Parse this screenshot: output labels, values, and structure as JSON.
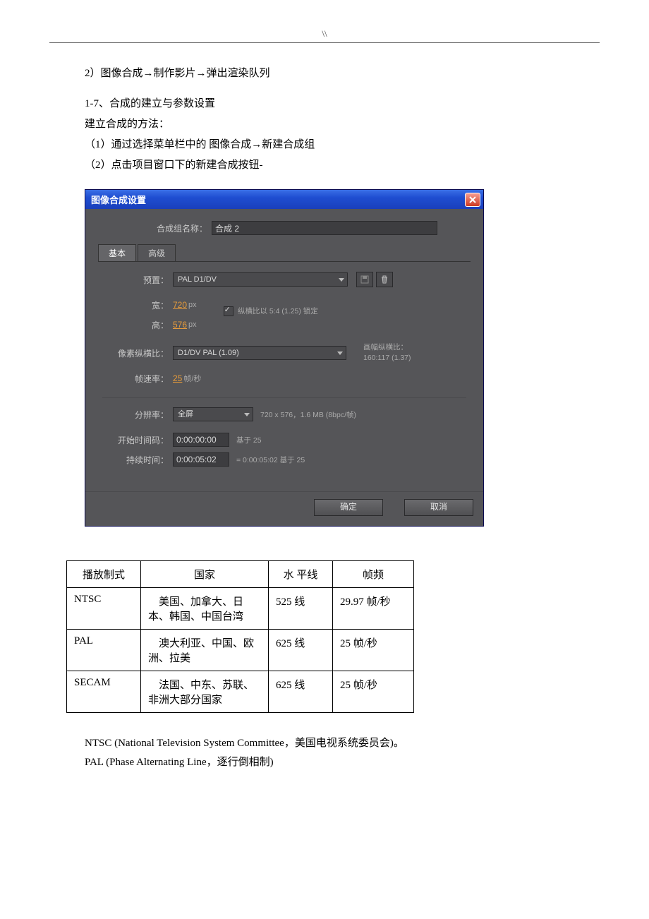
{
  "header_mark": "\\\\",
  "doc": {
    "line1": "2）图像合成→制作影片→弹出渲染队列",
    "line2": "1-7、合成的建立与参数设置",
    "line3": "建立合成的方法：",
    "line4": "（1）通过选择菜单栏中的 图像合成→新建合成组",
    "line5": "（2）点击项目窗口下的新建合成按钮-"
  },
  "dialog": {
    "title": "图像合成设置",
    "name_label": "合成组名称：",
    "name_value": "合成 2",
    "tab_basic": "基本",
    "tab_adv": "高级",
    "preset_label": "预置：",
    "preset_value": "PAL D1/DV",
    "width_label": "宽：",
    "width_value": "720",
    "height_label": "高：",
    "height_value": "576",
    "px": "px",
    "lock_ratio": "纵横比以 5:4 (1.25) 锁定",
    "par_label": "像素纵横比：",
    "par_value": "D1/DV PAL (1.09)",
    "frame_ratio_lbl": "画幅纵横比：",
    "frame_ratio_val": "160:117 (1.37)",
    "fps_label": "帧速率：",
    "fps_value": "25",
    "fps_unit": "帧/秒",
    "res_label": "分辨率：",
    "res_value": "全屏",
    "res_info": "720 x 576，1.6 MB (8bpc/帧)",
    "start_tc_label": "开始时间码：",
    "start_tc_value": "0:00:00:00",
    "start_tc_hint": "基于 25",
    "dur_label": "持续时间：",
    "dur_value": "0:00:05:02",
    "dur_hint": "= 0:00:05:02 基于 25",
    "ok": "确定",
    "cancel": "取消"
  },
  "table": {
    "h1": "播放制式",
    "h2": "国家",
    "h3": "水 平线",
    "h4": "帧频",
    "rows": [
      {
        "fmt": "NTSC",
        "country": "　美国、加拿大、日本、韩国、中国台湾",
        "lines": "525 线",
        "fps": "29.97 帧/秒"
      },
      {
        "fmt": "PAL",
        "country": "　澳大利亚、中国、欧洲、拉美",
        "lines": "625 线",
        "fps": "25 帧/秒"
      },
      {
        "fmt": "SECAM",
        "country": "　法国、中东、苏联、非洲大部分国家",
        "lines": "625 线",
        "fps": "25 帧/秒"
      }
    ]
  },
  "footnote": {
    "l1": "NTSC (National Television System Committee，美国电视系统委员会)。",
    "l2": "PAL (Phase Alternating Line，逐行倒相制)"
  }
}
